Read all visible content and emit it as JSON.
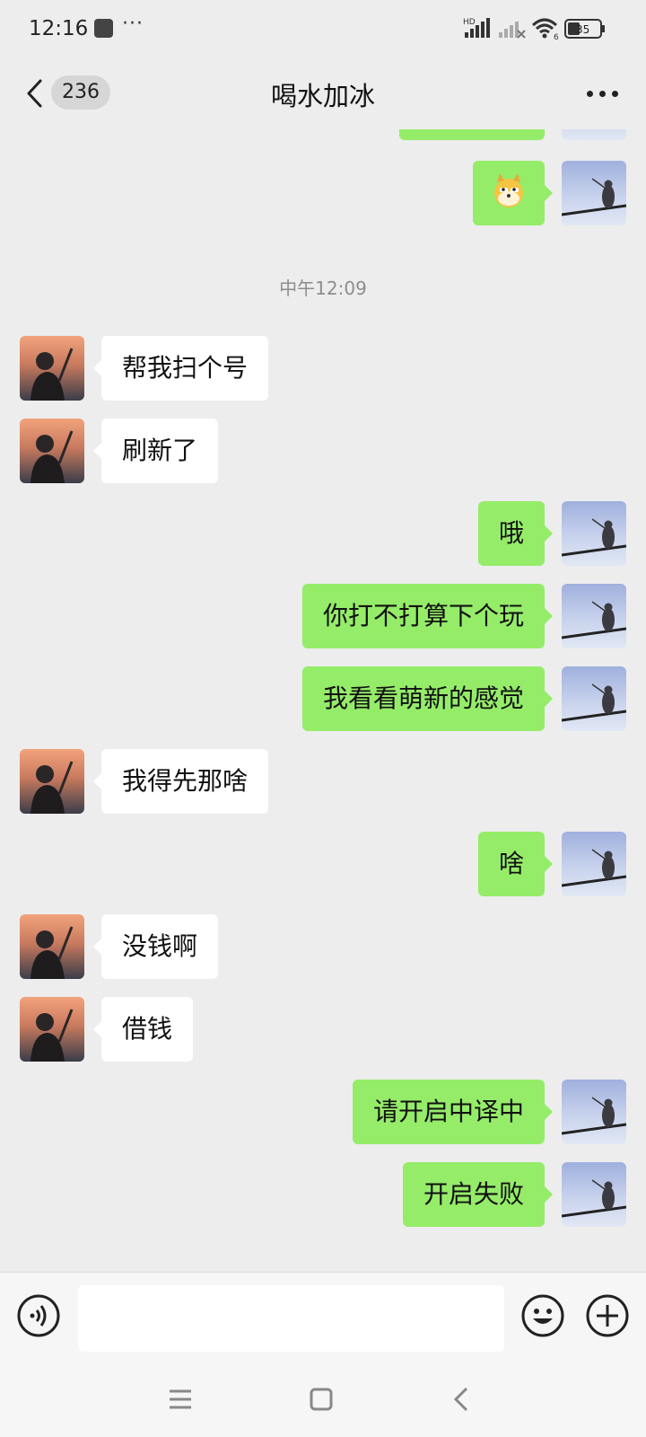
{
  "status_bar": {
    "time": "12:16",
    "dots": "···",
    "network_label": "HD",
    "wifi_label": "6",
    "battery": "35"
  },
  "header": {
    "unread_count": "236",
    "title": "喝水加冰"
  },
  "chat": {
    "time_divider": "中午12:09",
    "messages": [
      {
        "side": "in",
        "text": "帮我扫个号"
      },
      {
        "side": "in",
        "text": "刷新了"
      },
      {
        "side": "out",
        "text": "哦"
      },
      {
        "side": "out",
        "text": "你打不打算下个玩"
      },
      {
        "side": "out",
        "text": "我看看萌新的感觉"
      },
      {
        "side": "in",
        "text": "我得先那啥"
      },
      {
        "side": "out",
        "text": "啥"
      },
      {
        "side": "in",
        "text": "没钱啊"
      },
      {
        "side": "in",
        "text": "借钱"
      },
      {
        "side": "out",
        "text": "请开启中译中"
      },
      {
        "side": "out",
        "text": "开启失败"
      }
    ]
  },
  "input_bar": {
    "placeholder": ""
  },
  "colors": {
    "background": "#ededed",
    "outgoing_bubble": "#95ec69",
    "incoming_bubble": "#ffffff",
    "time_text": "#8d8d8d"
  },
  "icons": [
    "back-icon",
    "more-icon",
    "voice-icon",
    "emoji-icon",
    "plus-icon",
    "menu-icon",
    "home-icon",
    "back-nav-icon",
    "doge-sticker"
  ]
}
